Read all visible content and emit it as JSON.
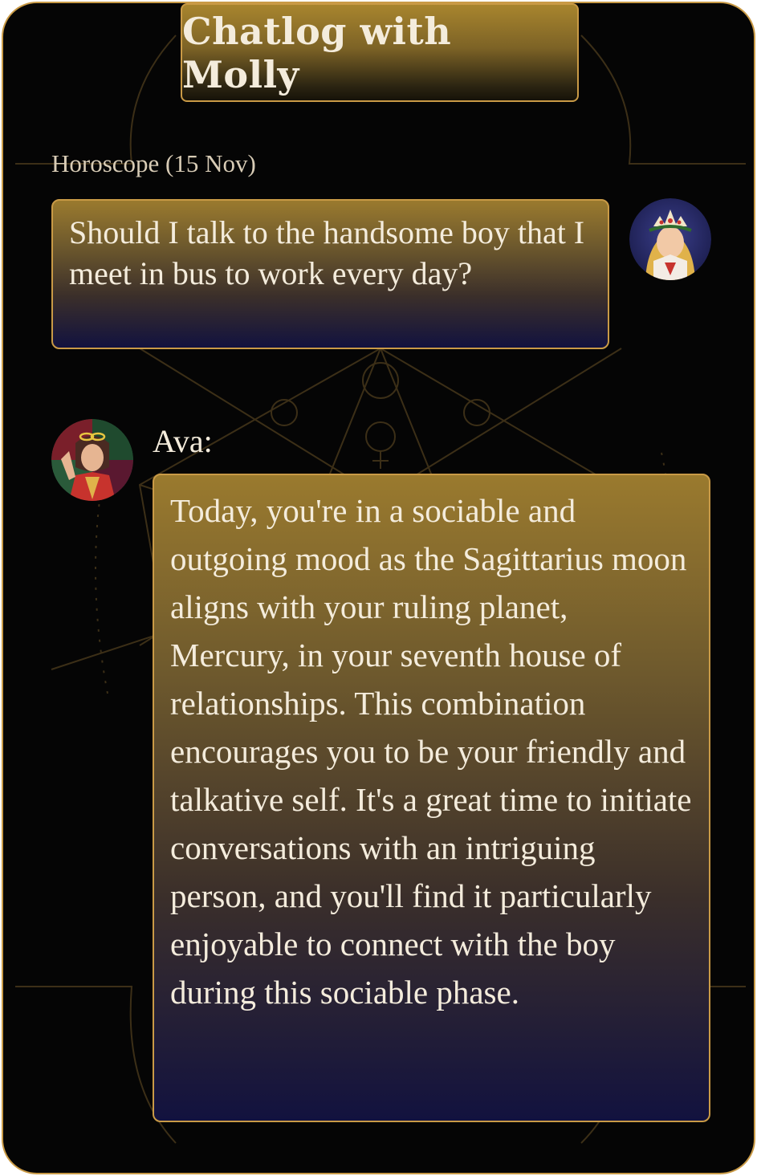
{
  "header": {
    "title": "Chatlog with Molly"
  },
  "section": {
    "label": "Horoscope (15 Nov)"
  },
  "user_message": {
    "text": "Should I talk to the handsome boy that I meet in bus to work every day?",
    "avatar_icon": "user-avatar-crowned-woman"
  },
  "reply": {
    "speaker": "Ava:",
    "avatar_icon": "ava-avatar-astrologer",
    "text": "Today, you're in a sociable and outgoing mood as the Sagittarius moon aligns with your ruling planet, Mercury, in your seventh house of relationships. This combination encourages you to be your friendly and talkative self. It's a great time to initiate conversations with an intriguing person, and you'll find it particularly enjoyable to connect with the boy during this sociable phase."
  },
  "colors": {
    "background": "#050505",
    "border_gold": "#c99a46",
    "text_light": "#f4ecdc",
    "label_text": "#d8ccb6",
    "bubble_top": "#9a7a2e",
    "bubble_bottom": "#12123f"
  }
}
